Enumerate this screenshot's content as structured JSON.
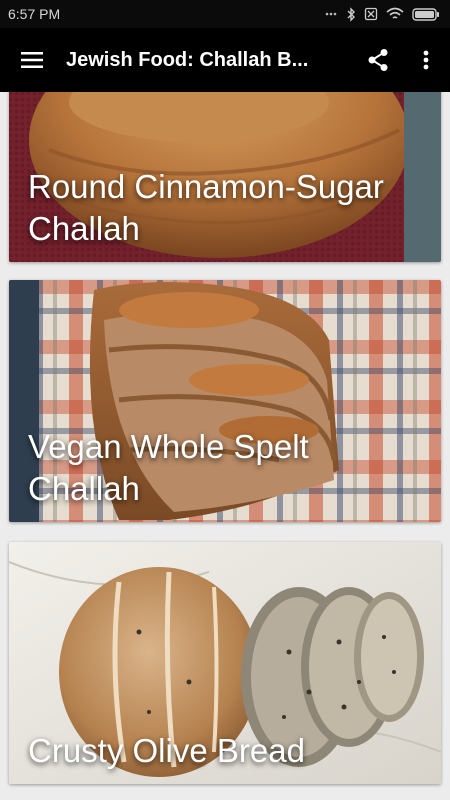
{
  "status": {
    "time": "6:57 PM",
    "icons": [
      "signal-dots-icon",
      "bluetooth-icon",
      "no-sim-icon",
      "wifi-icon",
      "battery-icon"
    ]
  },
  "app_bar": {
    "title": "Jewish Food: Challah B...",
    "icons": [
      "menu-icon",
      "share-icon",
      "more-vert-icon"
    ],
    "background": "#000000"
  },
  "recipes": [
    {
      "title": "Round Cinnamon-Sugar Challah",
      "image": "round-cinnamon-sugar-challah-photo"
    },
    {
      "title": "Vegan Whole Spelt Challah",
      "image": "vegan-whole-spelt-challah-photo"
    },
    {
      "title": "Crusty Olive Bread",
      "image": "crusty-olive-bread-photo"
    }
  ]
}
